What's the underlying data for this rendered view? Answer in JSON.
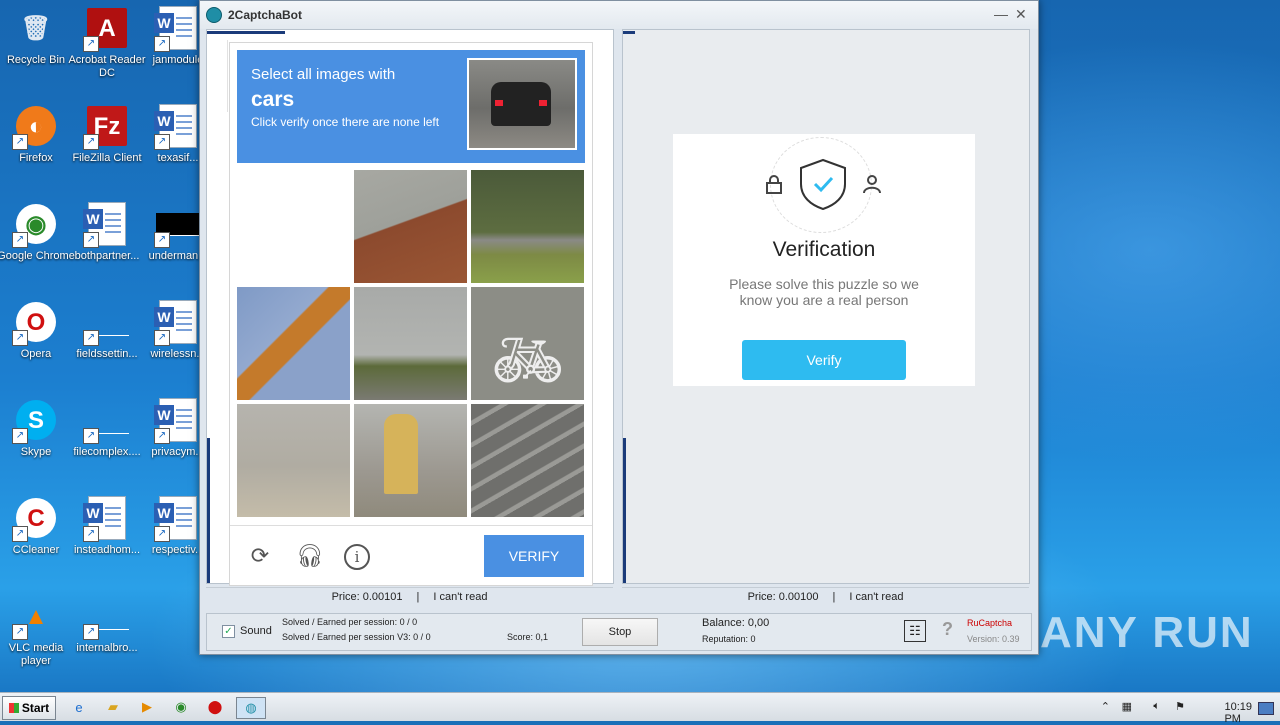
{
  "desktop": {
    "icons": [
      {
        "label": "Recycle Bin",
        "icon": "recycle-bin-icon"
      },
      {
        "label": "Acrobat Reader DC",
        "icon": "acrobat-icon"
      },
      {
        "label": "janmodule",
        "icon": "word-doc-icon"
      },
      {
        "label": "Firefox",
        "icon": "firefox-icon"
      },
      {
        "label": "FileZilla Client",
        "icon": "filezilla-icon"
      },
      {
        "label": "texasif...",
        "icon": "word-doc-icon"
      },
      {
        "label": "Google Chrome",
        "icon": "chrome-icon"
      },
      {
        "label": "bothpartner...",
        "icon": "word-doc-icon"
      },
      {
        "label": "underman...",
        "icon": "file-icon"
      },
      {
        "label": "Opera",
        "icon": "opera-icon"
      },
      {
        "label": "fieldssettin...",
        "icon": "file-icon"
      },
      {
        "label": "wirelessn...",
        "icon": "word-doc-icon"
      },
      {
        "label": "Skype",
        "icon": "skype-icon"
      },
      {
        "label": "filecomplex....",
        "icon": "file-icon"
      },
      {
        "label": "privacym...",
        "icon": "word-doc-icon"
      },
      {
        "label": "CCleaner",
        "icon": "ccleaner-icon"
      },
      {
        "label": "insteadhom...",
        "icon": "word-doc-icon"
      },
      {
        "label": "respectiv...",
        "icon": "word-doc-icon"
      },
      {
        "label": "VLC media player",
        "icon": "vlc-icon"
      },
      {
        "label": "internalbro...",
        "icon": "file-icon"
      }
    ]
  },
  "window": {
    "title": "2CaptchaBot",
    "minimize": "—",
    "close": "✕"
  },
  "captcha": {
    "prompt_line1": "Select all images with",
    "prompt_target": "cars",
    "prompt_line3": "Click verify once there are none left",
    "verify_label": "VERIFY",
    "tiles": [
      "blank",
      "rooftop",
      "road-car",
      "traffic-light",
      "street",
      "bike-lane",
      "palm",
      "hydrant",
      "crosswalk"
    ]
  },
  "left_status": {
    "price": "Price: 0.00101",
    "sep": "|",
    "cant_read": "I can't read"
  },
  "right_status": {
    "price": "Price: 0.00100",
    "sep": "|",
    "cant_read": "I can't read"
  },
  "verification": {
    "title": "Verification",
    "description": "Please solve this puzzle so we know you are a real person",
    "button": "Verify"
  },
  "bottom": {
    "sound_label": "Sound",
    "sound_checked": true,
    "solved_line1": "Solved / Earned per session: 0 / 0",
    "solved_line2": "Solved / Earned per session V3: 0 / 0",
    "score": "Score: 0,1",
    "stop_label": "Stop",
    "balance": "Balance:  0,00",
    "reputation": "Reputation: 0",
    "service": "RuCaptcha",
    "version": "Version: 0.39"
  },
  "taskbar": {
    "start_label": "Start",
    "clock": "10:19 PM"
  },
  "watermark": "ANY RUN",
  "colors": {
    "accent": "#4a90e2",
    "verify_btn": "#2ebbf0",
    "desktop": "#1c7fd0"
  }
}
